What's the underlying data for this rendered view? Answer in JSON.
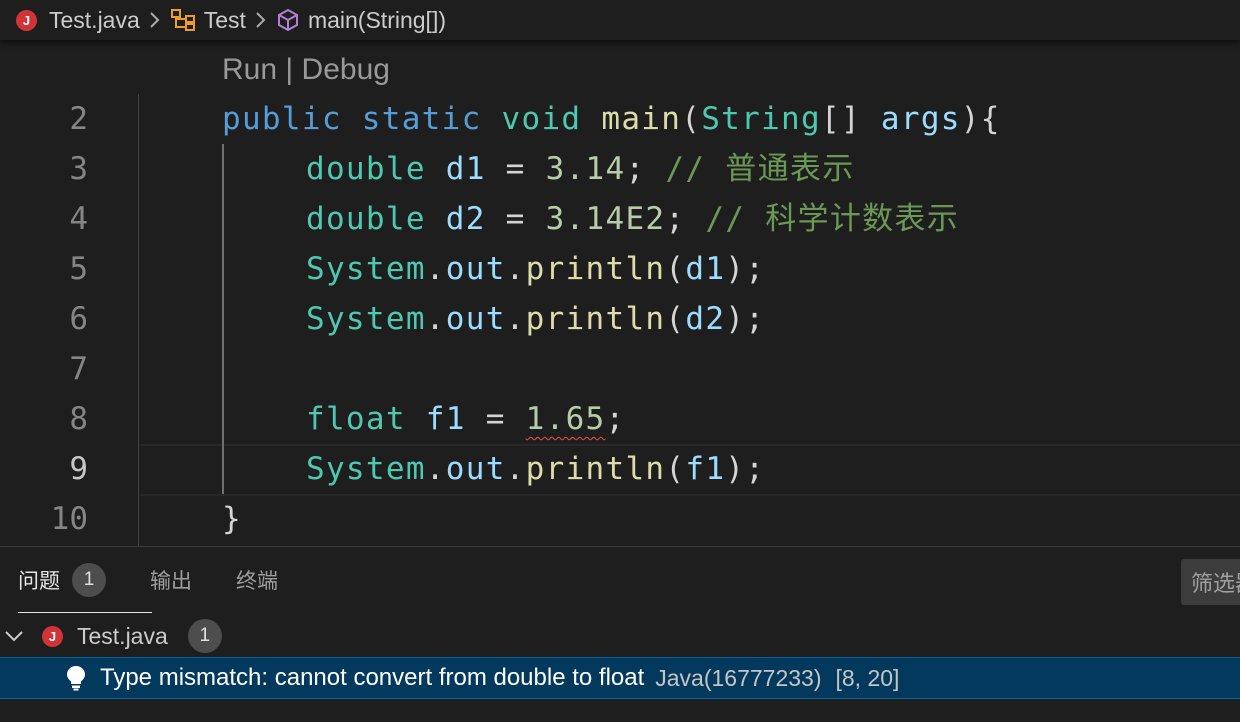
{
  "breadcrumb": {
    "file": "Test.java",
    "file_icon": "J",
    "class": "Test",
    "method": "main(String[])"
  },
  "editor": {
    "codelens": {
      "run": "Run",
      "separator": "|",
      "debug": "Debug"
    },
    "lines": [
      {
        "number": "2",
        "tokens": [
          [
            "public",
            "kw"
          ],
          [
            " ",
            "pn"
          ],
          [
            "static",
            "kw"
          ],
          [
            " ",
            "pn"
          ],
          [
            "void",
            "ty"
          ],
          [
            " ",
            "pn"
          ],
          [
            "main",
            "fn"
          ],
          [
            "(",
            "pn"
          ],
          [
            "String",
            "ty"
          ],
          [
            "[] ",
            "pn"
          ],
          [
            "args",
            "var"
          ],
          [
            "){",
            "pn"
          ]
        ]
      },
      {
        "number": "3",
        "tokens": [
          [
            "double",
            "ty"
          ],
          [
            " ",
            "pn"
          ],
          [
            "d1",
            "var"
          ],
          [
            " = ",
            "pn"
          ],
          [
            "3.14",
            "num"
          ],
          [
            "; ",
            "pn"
          ],
          [
            "// 普通表示",
            "cm"
          ]
        ]
      },
      {
        "number": "4",
        "tokens": [
          [
            "double",
            "ty"
          ],
          [
            " ",
            "pn"
          ],
          [
            "d2",
            "var"
          ],
          [
            " = ",
            "pn"
          ],
          [
            "3.14E2",
            "num"
          ],
          [
            "; ",
            "pn"
          ],
          [
            "// 科学计数表示",
            "cm"
          ]
        ]
      },
      {
        "number": "5",
        "tokens": [
          [
            "System",
            "ty"
          ],
          [
            ".",
            "pn"
          ],
          [
            "out",
            "var"
          ],
          [
            ".",
            "pn"
          ],
          [
            "println",
            "fn"
          ],
          [
            "(",
            "pn"
          ],
          [
            "d1",
            "var"
          ],
          [
            ");",
            "pn"
          ]
        ]
      },
      {
        "number": "6",
        "tokens": [
          [
            "System",
            "ty"
          ],
          [
            ".",
            "pn"
          ],
          [
            "out",
            "var"
          ],
          [
            ".",
            "pn"
          ],
          [
            "println",
            "fn"
          ],
          [
            "(",
            "pn"
          ],
          [
            "d2",
            "var"
          ],
          [
            ");",
            "pn"
          ]
        ]
      },
      {
        "number": "7",
        "tokens": []
      },
      {
        "number": "8",
        "tokens": [
          [
            "float",
            "ty"
          ],
          [
            " ",
            "pn"
          ],
          [
            "f1",
            "var"
          ],
          [
            " = ",
            "pn"
          ],
          [
            "1.65",
            "num squiggle"
          ],
          [
            ";",
            "pn"
          ]
        ]
      },
      {
        "number": "9",
        "tokens": [
          [
            "System",
            "ty"
          ],
          [
            ".",
            "pn"
          ],
          [
            "out",
            "var"
          ],
          [
            ".",
            "pn"
          ],
          [
            "println",
            "fn"
          ],
          [
            "(",
            "pn"
          ],
          [
            "f1",
            "var"
          ],
          [
            ");",
            "pn"
          ]
        ]
      },
      {
        "number": "10",
        "tokens": [
          [
            "}",
            "pn"
          ]
        ]
      }
    ],
    "active_line": "9"
  },
  "panel": {
    "tabs": [
      {
        "label": "问题",
        "badge": "1",
        "active": true
      },
      {
        "label": "输出"
      },
      {
        "label": "终端"
      }
    ],
    "filter_placeholder": "筛选器",
    "file_row": {
      "name": "Test.java",
      "badge": "1"
    },
    "problem": {
      "message": "Type mismatch: cannot convert from double to float",
      "source": "Java(16777233)",
      "position": "[8, 20]"
    }
  },
  "colors": {
    "background": "#1e1e1e",
    "keyword": "#569cd6",
    "type": "#4ec9b0",
    "function": "#dcdcaa",
    "variable": "#9cdcfe",
    "number": "#b5cea8",
    "comment": "#6a9955",
    "error": "#d13438",
    "selection": "#04395e"
  }
}
